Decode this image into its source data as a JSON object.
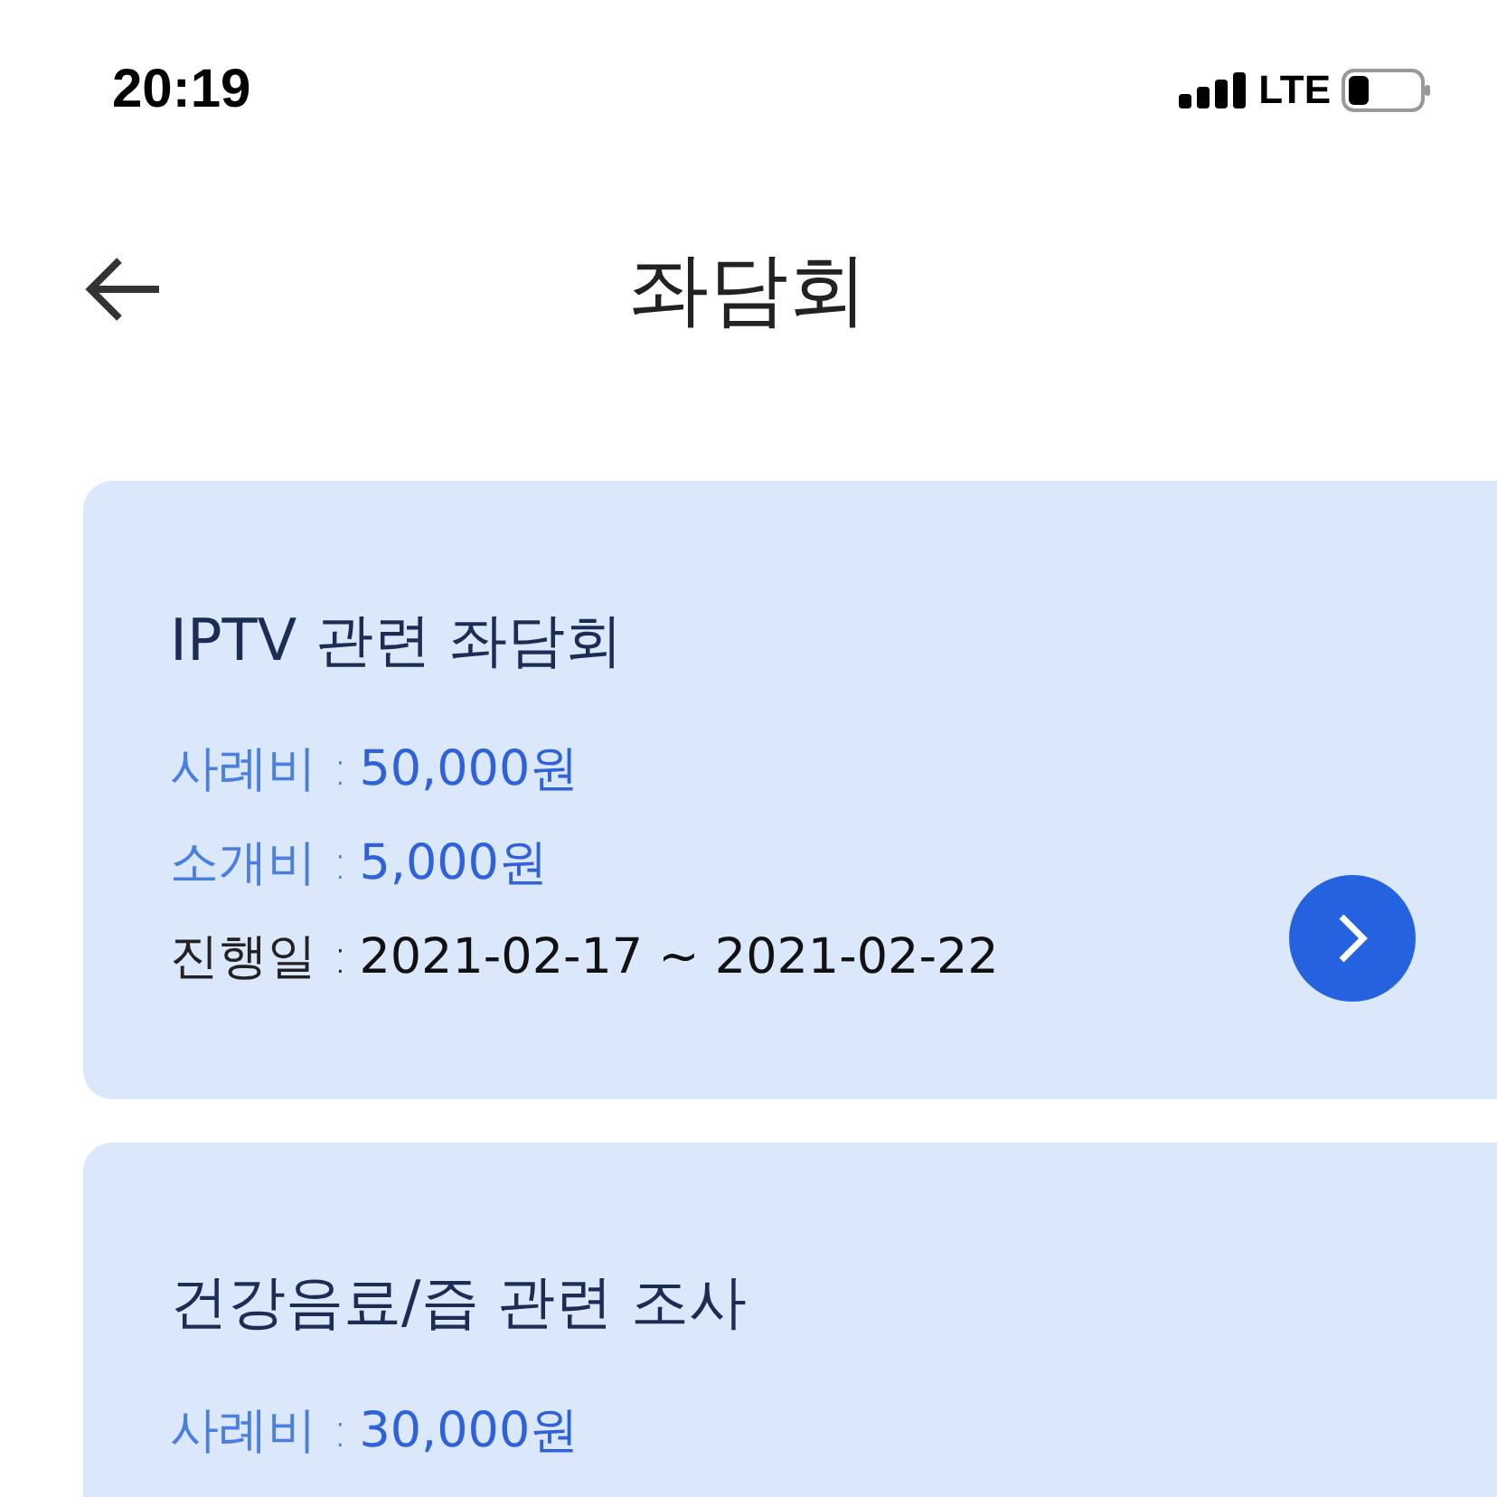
{
  "status_bar": {
    "time": "20:19",
    "network": "LTE"
  },
  "header": {
    "title": "좌담회"
  },
  "cards": [
    {
      "title": "IPTV 관련 좌담회",
      "details": [
        {
          "kind": "fee",
          "label": "사례비 :",
          "value": "50,000원"
        },
        {
          "kind": "fee",
          "label": "소개비 :",
          "value": "5,000원"
        },
        {
          "kind": "date",
          "label": "진행일 :",
          "value": "2021-02-17 ~ 2021-02-22"
        }
      ],
      "has_button": true
    },
    {
      "title": "건강음료/즙 관련 조사",
      "details": [
        {
          "kind": "fee",
          "label": "사례비 :",
          "value": "30,000원"
        }
      ],
      "has_button": false
    }
  ]
}
